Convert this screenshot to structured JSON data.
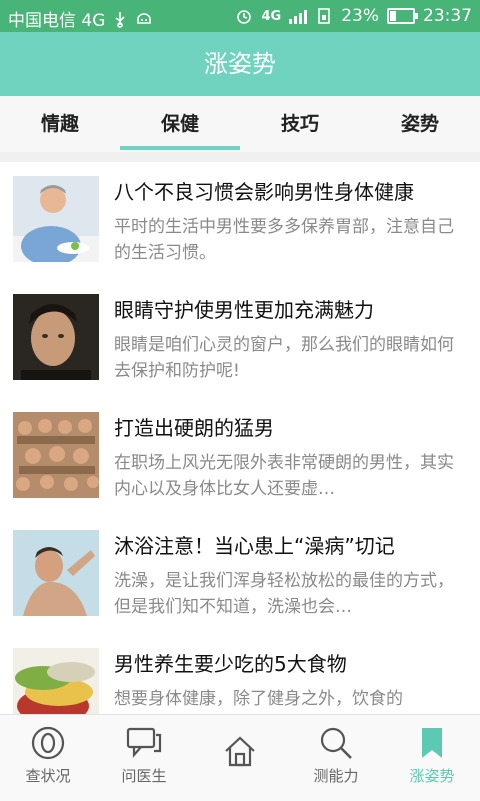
{
  "statusbar": {
    "carrier": "中国电信 4G",
    "network": "4G",
    "battery_percent_text": "23%",
    "battery_level": 0.23,
    "time": "23:37"
  },
  "header": {
    "title": "涨姿势"
  },
  "tabs": [
    {
      "label": "情趣",
      "active": false
    },
    {
      "label": "保健",
      "active": true
    },
    {
      "label": "技巧",
      "active": false
    },
    {
      "label": "姿势",
      "active": false
    }
  ],
  "articles": [
    {
      "title": "八个不良习惯会影响男性身体健康",
      "summary": "平时的生活中男性要多多保养胃部，注意自己的生活习惯。"
    },
    {
      "title": "眼睛守护使男性更加充满魅力",
      "summary": "眼睛是咱们心灵的窗户，那么我们的眼睛如何去保护和防护呢!"
    },
    {
      "title": "打造出硬朗的猛男",
      "summary": "在职场上风光无限外表非常硬朗的男性，其实内心以及身体比女人还要虚…"
    },
    {
      "title": "沐浴注意！当心患上“澡病”切记",
      "summary": "洗澡，是让我们浑身轻松放松的最佳的方式，但是我们知不知道，洗澡也会…"
    },
    {
      "title": "男性养生要少吃的5大食物",
      "summary": "想要身体健康，除了健身之外，饮食的"
    }
  ],
  "bottom_nav": [
    {
      "label": "查状况",
      "icon": "circle-icon",
      "active": false
    },
    {
      "label": "问医生",
      "icon": "chat-icon",
      "active": false
    },
    {
      "label": "",
      "icon": "home-icon",
      "active": false
    },
    {
      "label": "测能力",
      "icon": "search-icon",
      "active": false
    },
    {
      "label": "涨姿势",
      "icon": "bookmark-icon",
      "active": true
    }
  ],
  "colors": {
    "statusbar": "#48b478",
    "accent": "#6fd3bf",
    "active_nav": "#5cc9b2"
  }
}
